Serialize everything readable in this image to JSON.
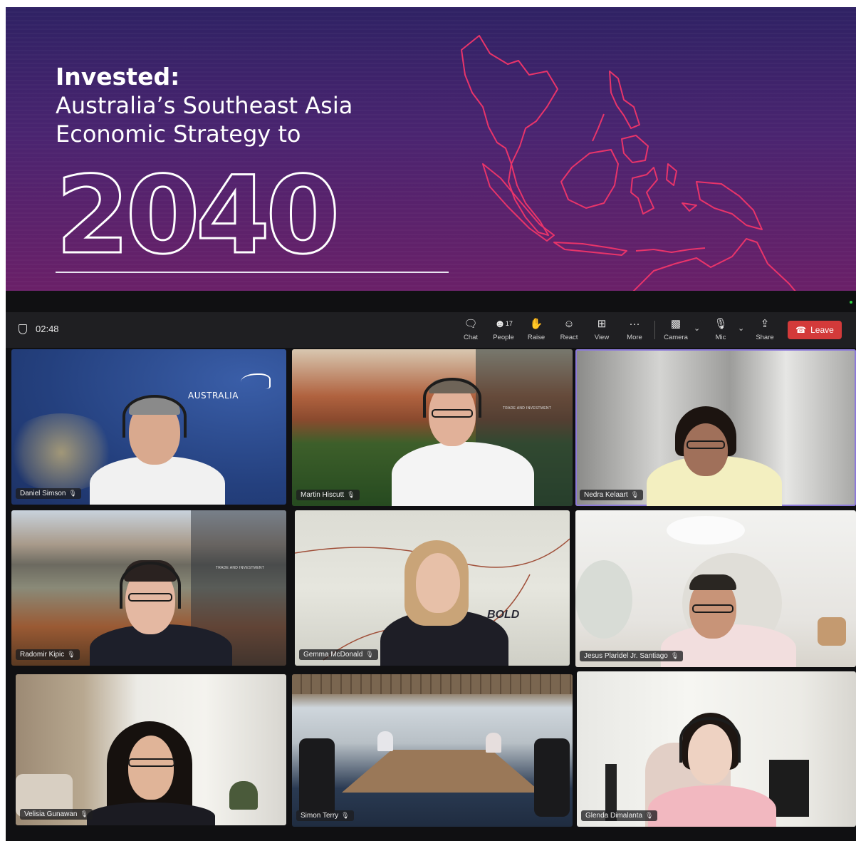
{
  "slide": {
    "heading_bold": "Invested:",
    "heading_line1": "Australia’s Southeast Asia",
    "heading_line2": "Economic Strategy to",
    "year": "2040"
  },
  "toolbar": {
    "timer": "02:48",
    "buttons": {
      "chat": "Chat",
      "people": "People",
      "people_count": "17",
      "raise": "Raise",
      "react": "React",
      "view": "View",
      "more": "More",
      "camera": "Camera",
      "mic": "Mic",
      "share": "Share"
    },
    "leave_label": "Leave"
  },
  "participants": [
    {
      "name": "Daniel Simson"
    },
    {
      "name": "Martin Hiscutt"
    },
    {
      "name": "Nedra Kelaart"
    },
    {
      "name": "Radomir Kipic"
    },
    {
      "name": "Gemma McDonald"
    },
    {
      "name": "Jesus Plaridel Jr. Santiago"
    },
    {
      "name": "Velisia Gunawan"
    },
    {
      "name": "Simon Terry"
    },
    {
      "name": "Glenda Dimalanta"
    }
  ],
  "background_text": {
    "australia": "AUSTRALIA",
    "trade": "TRADE AND INVESTMENT",
    "brand": "BOLD"
  },
  "colors": {
    "slide_top": "#2f2264",
    "slide_bottom": "#6a2068",
    "map_stroke": "#e8346a",
    "leave_button": "#d33a3a",
    "active_speaker": "#8c7ad8"
  }
}
